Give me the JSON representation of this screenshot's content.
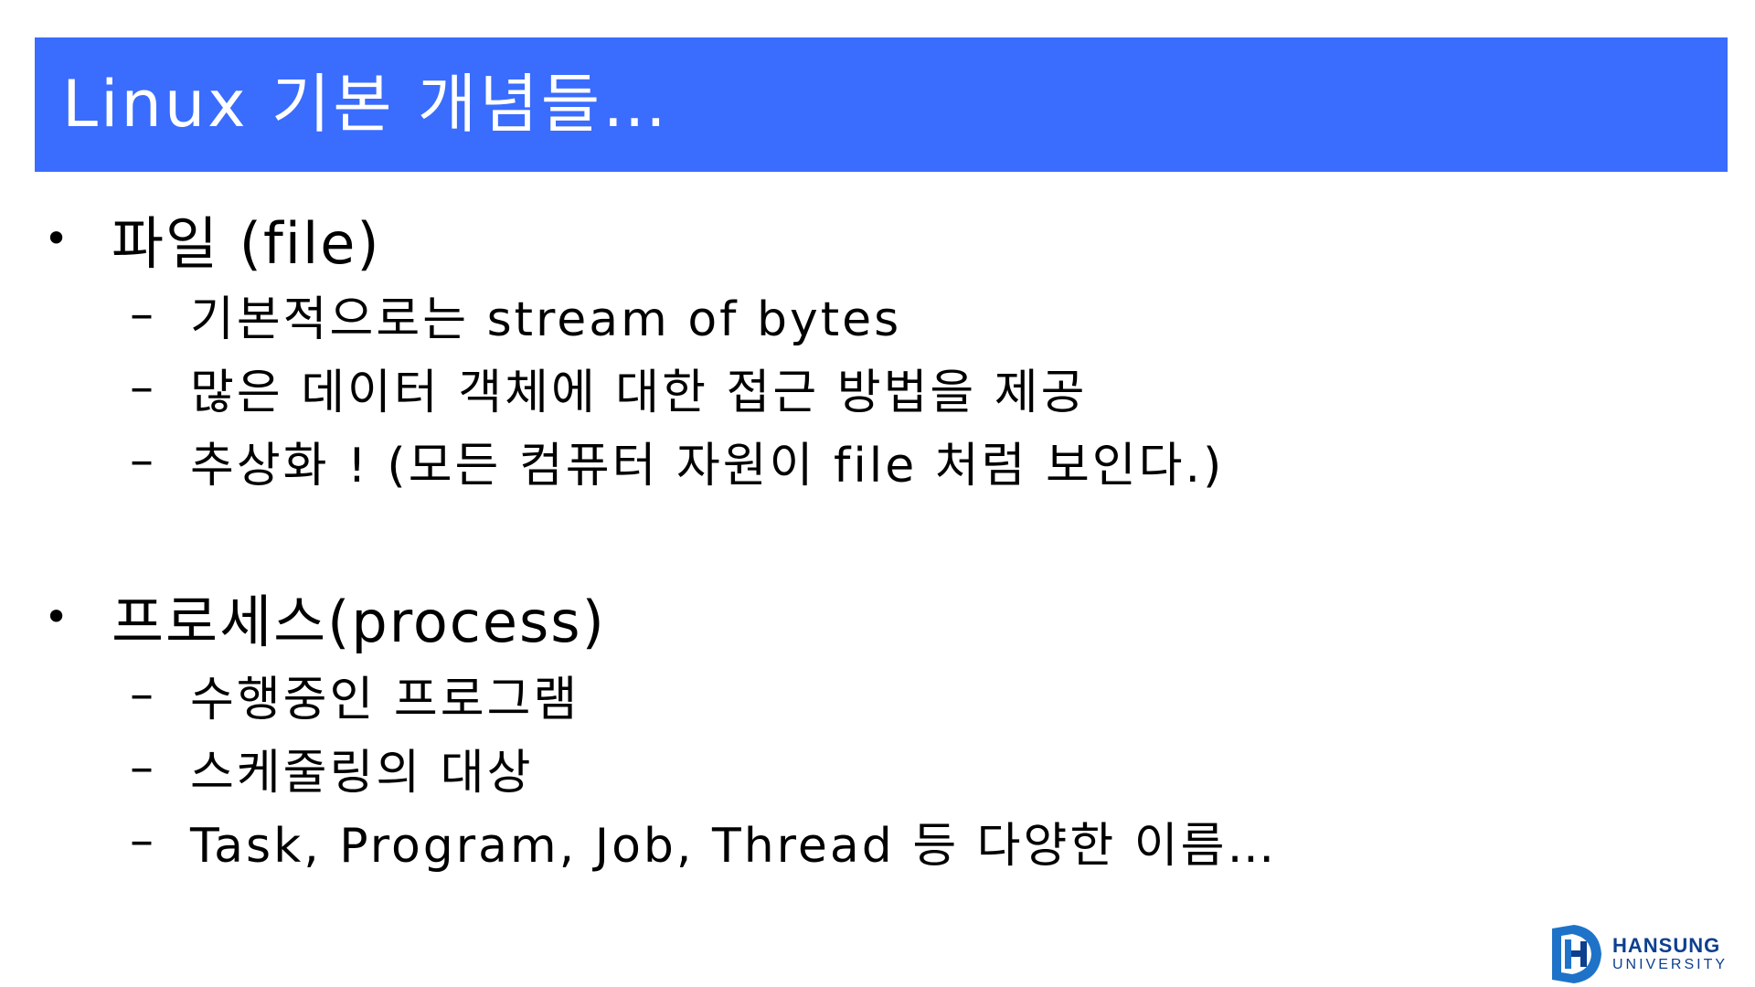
{
  "title": "Linux 기본 개념들…",
  "sections": [
    {
      "bullet": "•",
      "heading": "파일 (file)",
      "items": [
        "기본적으로는 stream of bytes",
        "많은 데이터 객체에 대한 접근 방법을 제공",
        "추상화 ! (모든 컴퓨터 자원이 file 처럼 보인다.)"
      ]
    },
    {
      "bullet": "•",
      "heading": "프로세스(process)",
      "items": [
        "수행중인 프로그램",
        "스케줄링의 대상",
        "Task, Program, Job, Thread 등 다양한 이름…"
      ]
    }
  ],
  "dash": "–",
  "logo": {
    "name": "HANSUNG",
    "sub": "UNIVERSITY"
  },
  "colors": {
    "title_bar": "#3a6cfd",
    "title_text": "#ffffff",
    "logo": "#0d3f8f"
  }
}
